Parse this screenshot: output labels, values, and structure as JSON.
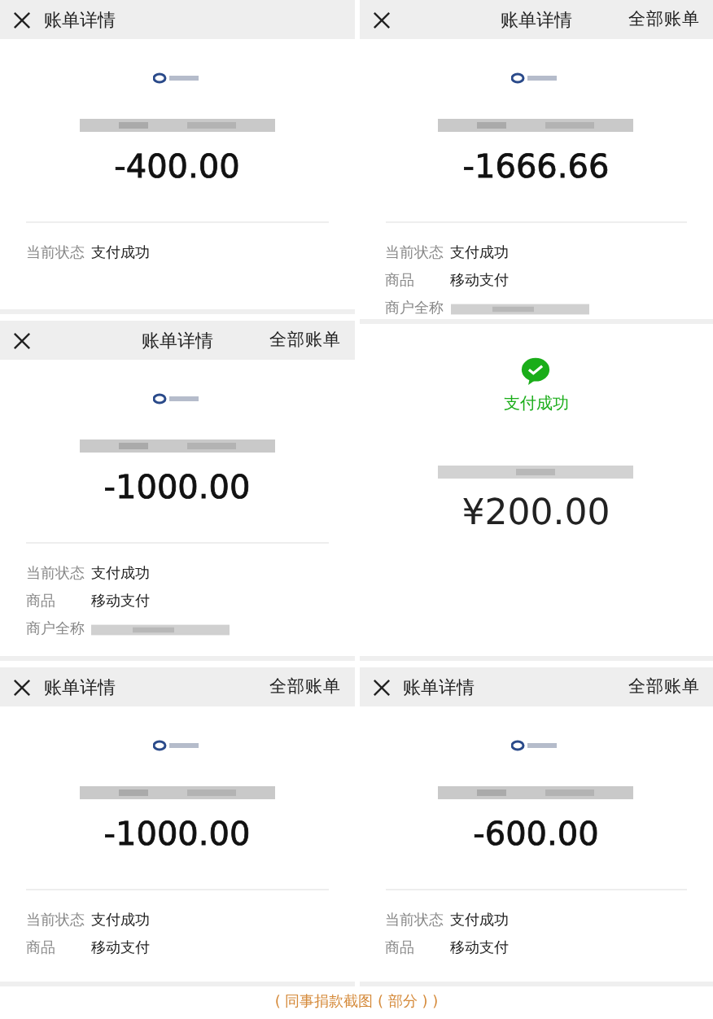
{
  "columns": [
    {
      "panels": [
        {
          "kind": "bill",
          "header": {
            "kind": "left",
            "title": "账单详情"
          },
          "amount": "-400.00",
          "rows": [
            {
              "label": "当前状态",
              "value": "支付成功",
              "kind": "text"
            }
          ]
        },
        {
          "kind": "bill",
          "header": {
            "kind": "center",
            "title": "账单详情",
            "link": "全部账单"
          },
          "amount": "-1000.00",
          "rows": [
            {
              "label": "当前状态",
              "value": "支付成功",
              "kind": "text"
            },
            {
              "label": "商品",
              "value": "移动支付",
              "kind": "text"
            },
            {
              "label": "商户全称",
              "kind": "blurred"
            }
          ]
        },
        {
          "kind": "bill",
          "header": {
            "kind": "left",
            "title": "账单详情",
            "link": "全部账单"
          },
          "amount": "-1000.00",
          "rows": [
            {
              "label": "当前状态",
              "value": "支付成功",
              "kind": "text"
            },
            {
              "label": "商品",
              "value": "移动支付",
              "kind": "text"
            }
          ]
        }
      ]
    },
    {
      "panels": [
        {
          "kind": "bill",
          "header": {
            "kind": "center",
            "title": "账单详情",
            "link": "全部账单"
          },
          "amount": "-1666.66",
          "rows": [
            {
              "label": "当前状态",
              "value": "支付成功",
              "kind": "text"
            },
            {
              "label": "商品",
              "value": "移动支付",
              "kind": "text"
            },
            {
              "label": "商户全称",
              "kind": "blurred"
            }
          ]
        },
        {
          "kind": "success",
          "status": "支付成功",
          "amount": "¥200.00"
        },
        {
          "kind": "bill",
          "header": {
            "kind": "left",
            "title": "账单详情",
            "link": "全部账单"
          },
          "amount": "-600.00",
          "rows": [
            {
              "label": "当前状态",
              "value": "支付成功",
              "kind": "text"
            },
            {
              "label": "商品",
              "value": "移动支付",
              "kind": "text"
            }
          ]
        }
      ]
    }
  ],
  "caption": "( 同事捐款截图 ( 部分 ) )"
}
